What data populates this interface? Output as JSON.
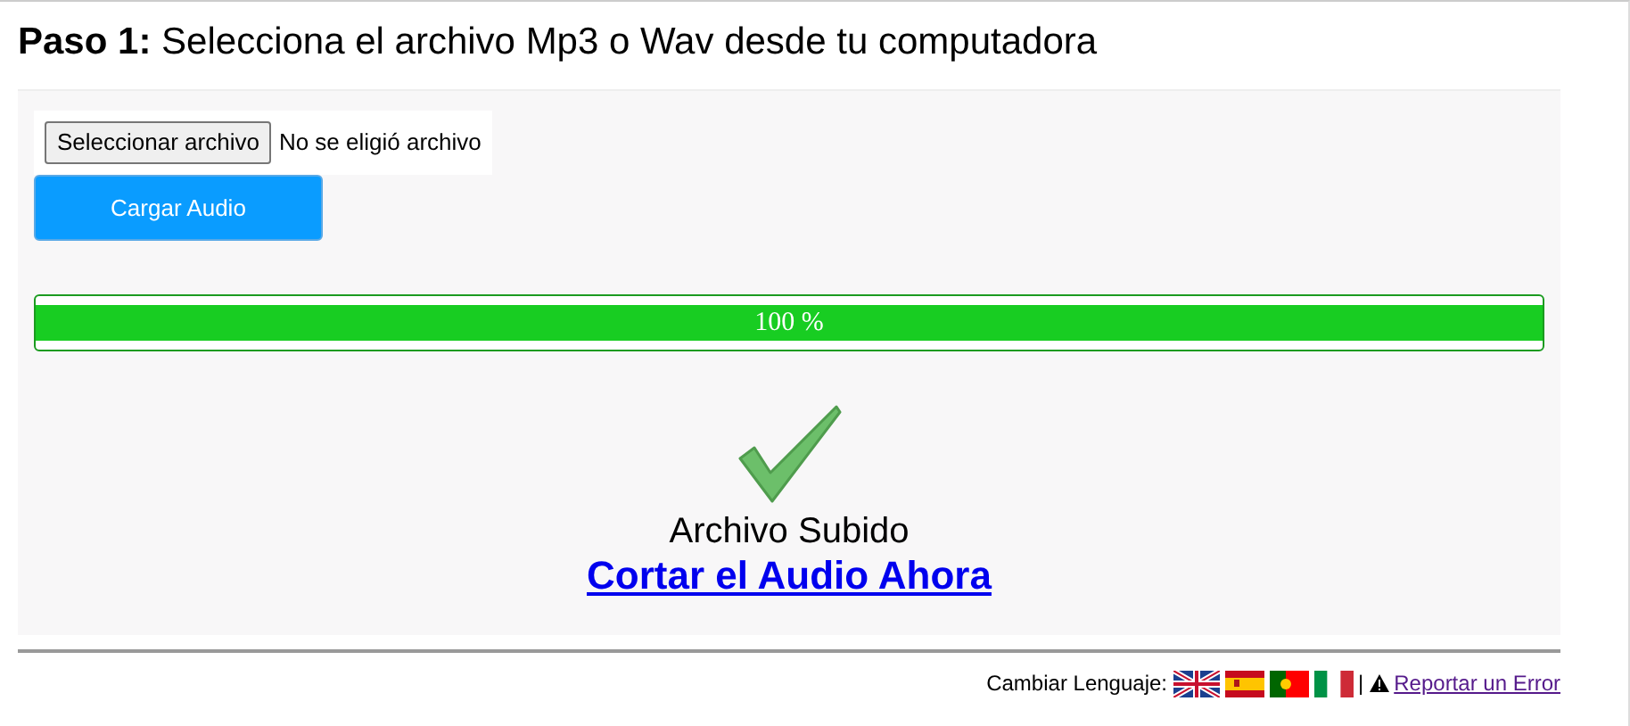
{
  "heading": {
    "step": "Paso 1:",
    "text": "Selecciona el archivo Mp3 o Wav desde tu computadora"
  },
  "file_picker": {
    "button": "Seleccionar archivo",
    "status": "No se eligió archivo"
  },
  "upload_button": "Cargar Audio",
  "progress": {
    "level": 1.0,
    "reading": "100 %"
  },
  "result": {
    "message": "Archivo Subido",
    "link": "Cortar el Audio Ahora"
  },
  "footer": {
    "language_label": "Cambiar Lenguaje:",
    "separator": "|",
    "report_link": "Reportar un Error"
  }
}
